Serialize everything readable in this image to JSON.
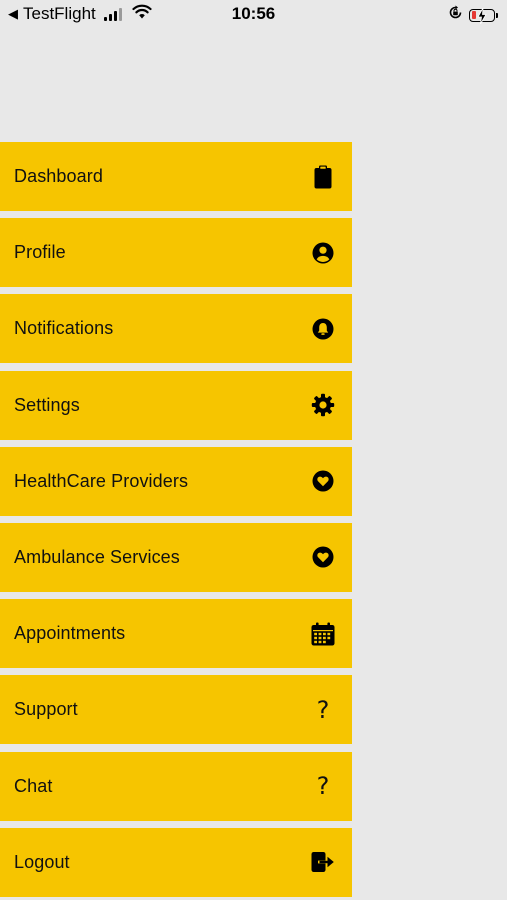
{
  "status_bar": {
    "back_app": "TestFlight",
    "time": "10:56"
  },
  "menu": {
    "items": [
      {
        "label": "Dashboard",
        "icon": "clipboard-icon"
      },
      {
        "label": "Profile",
        "icon": "user-circle-icon"
      },
      {
        "label": "Notifications",
        "icon": "bell-icon"
      },
      {
        "label": "Settings",
        "icon": "gear-icon"
      },
      {
        "label": "HealthCare Providers",
        "icon": "heart-icon"
      },
      {
        "label": "Ambulance Services",
        "icon": "heart-icon"
      },
      {
        "label": "Appointments",
        "icon": "calendar-icon"
      },
      {
        "label": "Support",
        "icon": "question-icon",
        "glyph": "?"
      },
      {
        "label": "Chat",
        "icon": "question-icon",
        "glyph": "?"
      },
      {
        "label": "Logout",
        "icon": "logout-icon"
      }
    ]
  },
  "colors": {
    "menu_background": "#f6c500",
    "screen_background": "#e8e8e8",
    "text": "#111111",
    "battery_low": "#e53935"
  }
}
